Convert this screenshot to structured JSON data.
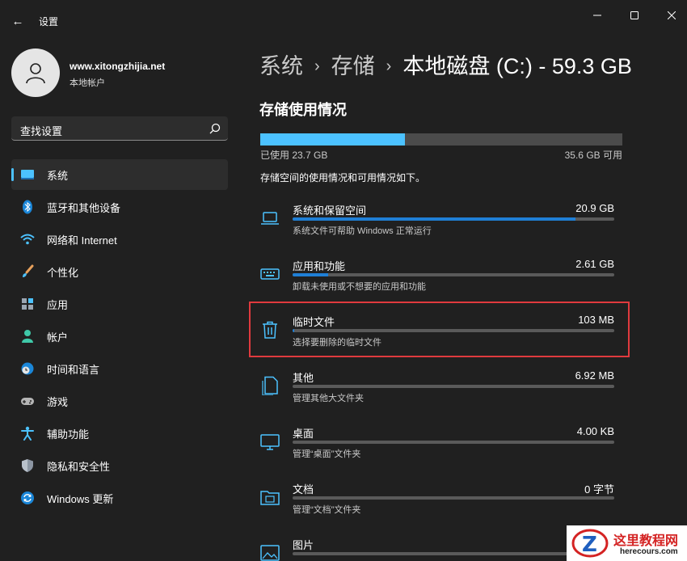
{
  "window": {
    "title": "设置",
    "back_glyph": "←",
    "controls": [
      "minimize-icon",
      "maximize-icon",
      "close-icon"
    ]
  },
  "profile": {
    "name": "www.xitongzhijia.net",
    "account_type": "本地帐户"
  },
  "search": {
    "placeholder": "查找设置"
  },
  "nav": {
    "items": [
      {
        "label": "系统",
        "icon": "display-icon",
        "active": true
      },
      {
        "label": "蓝牙和其他设备",
        "icon": "bluetooth-icon"
      },
      {
        "label": "网络和 Internet",
        "icon": "wifi-icon"
      },
      {
        "label": "个性化",
        "icon": "brush-icon"
      },
      {
        "label": "应用",
        "icon": "apps-icon"
      },
      {
        "label": "帐户",
        "icon": "person-icon"
      },
      {
        "label": "时间和语言",
        "icon": "globe-clock-icon"
      },
      {
        "label": "游戏",
        "icon": "gamepad-icon"
      },
      {
        "label": "辅助功能",
        "icon": "accessibility-icon"
      },
      {
        "label": "隐私和安全性",
        "icon": "shield-icon"
      },
      {
        "label": "Windows 更新",
        "icon": "update-icon"
      }
    ]
  },
  "breadcrumb": {
    "level1": "系统",
    "level2": "存储",
    "current": "本地磁盘 (C:) - 59.3 GB",
    "separator": "›"
  },
  "storage": {
    "section_title": "存储使用情况",
    "used_label": "已使用 23.7 GB",
    "free_label": "35.6 GB 可用",
    "used_fraction": 0.4,
    "description": "存储空间的使用情况和可用情况如下。",
    "accent_color": "#4cc2ff"
  },
  "categories": [
    {
      "name": "系统和保留空间",
      "size": "20.9 GB",
      "sub": "系统文件可帮助 Windows 正常运行",
      "fraction": 0.88,
      "icon": "laptop-icon"
    },
    {
      "name": "应用和功能",
      "size": "2.61 GB",
      "sub": "卸载未使用或不想要的应用和功能",
      "fraction": 0.11,
      "icon": "keyboard-icon"
    },
    {
      "name": "临时文件",
      "size": "103 MB",
      "sub": "选择要删除的临时文件",
      "fraction": 0.004,
      "icon": "trash-icon",
      "highlighted": true
    },
    {
      "name": "其他",
      "size": "6.92 MB",
      "sub": "管理其他大文件夹",
      "fraction": 0.0,
      "icon": "document-icon"
    },
    {
      "name": "桌面",
      "size": "4.00 KB",
      "sub": "管理“桌面”文件夹",
      "fraction": 0.0,
      "icon": "monitor-icon"
    },
    {
      "name": "文档",
      "size": "0 字节",
      "sub": "管理“文档”文件夹",
      "fraction": 0.0,
      "icon": "folder-icon"
    },
    {
      "name": "图片",
      "size": "",
      "sub": "",
      "fraction": 0.0,
      "icon": "picture-icon"
    }
  ],
  "watermark": {
    "title": "这里教程网",
    "url": "herecours.com"
  }
}
